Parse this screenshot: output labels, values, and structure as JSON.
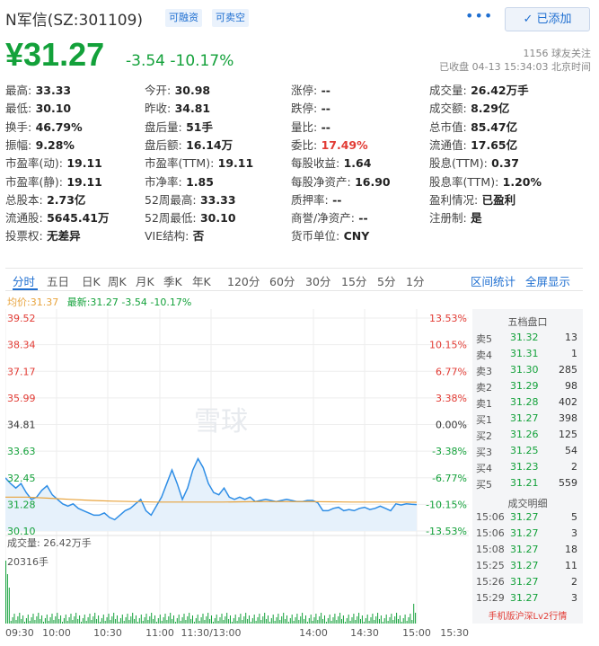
{
  "header": {
    "name": "N军信(SZ:301109)",
    "tags": [
      "可融资",
      "可卖空"
    ],
    "more": "•••",
    "follow_label": "✓ 已添加"
  },
  "price": {
    "current": "¥31.27",
    "change": "-3.54 -10.17%",
    "followers": "1156 球友关注",
    "status": "已收盘 04-13 15:34:03 北京时间"
  },
  "quote": [
    {
      "k": "最高:",
      "v": "33.33"
    },
    {
      "k": "今开:",
      "v": "30.98"
    },
    {
      "k": "涨停:",
      "v": "--"
    },
    {
      "k": "成交量:",
      "v": "26.42万手"
    },
    {
      "k": "最低:",
      "v": "30.10"
    },
    {
      "k": "昨收:",
      "v": "34.81"
    },
    {
      "k": "跌停:",
      "v": "--"
    },
    {
      "k": "成交额:",
      "v": "8.29亿"
    },
    {
      "k": "换手:",
      "v": "46.79%"
    },
    {
      "k": "盘后量:",
      "v": "51手"
    },
    {
      "k": "量比:",
      "v": "--"
    },
    {
      "k": "总市值:",
      "v": "85.47亿"
    },
    {
      "k": "振幅:",
      "v": "9.28%"
    },
    {
      "k": "盘后额:",
      "v": "16.14万"
    },
    {
      "k": "委比:",
      "v": "17.49%"
    },
    {
      "k": "流通值:",
      "v": "17.65亿"
    },
    {
      "k": "市盈率(动):",
      "v": "19.11"
    },
    {
      "k": "市盈率(TTM):",
      "v": "19.11"
    },
    {
      "k": "每股收益:",
      "v": "1.64"
    },
    {
      "k": "股息(TTM):",
      "v": "0.37"
    },
    {
      "k": "市盈率(静):",
      "v": "19.11"
    },
    {
      "k": "市净率:",
      "v": "1.85"
    },
    {
      "k": "每股净资产:",
      "v": "16.90"
    },
    {
      "k": "股息率(TTM):",
      "v": "1.20%"
    },
    {
      "k": "总股本:",
      "v": "2.73亿"
    },
    {
      "k": "52周最高:",
      "v": "33.33"
    },
    {
      "k": "质押率:",
      "v": "--"
    },
    {
      "k": "盈利情况:",
      "v": "已盈利"
    },
    {
      "k": "流通股:",
      "v": "5645.41万"
    },
    {
      "k": "52周最低:",
      "v": "30.10"
    },
    {
      "k": "商誉/净资产:",
      "v": "--"
    },
    {
      "k": "注册制:",
      "v": "是"
    },
    {
      "k": "投票权:",
      "v": "无差异"
    },
    {
      "k": "VIE结构:",
      "v": "否"
    },
    {
      "k": "货币单位:",
      "v": "CNY"
    }
  ],
  "tabs": [
    "分时",
    "五日",
    "日K",
    "周K",
    "月K",
    "季K",
    "年K",
    "120分",
    "60分",
    "30分",
    "15分",
    "5分",
    "1分"
  ],
  "tab_actions": [
    "区间统计",
    "全屏显示"
  ],
  "avg_line": {
    "avg": "均价:31.37",
    "latest": "最新:31.27 -3.54 -10.17%"
  },
  "chart_data": {
    "type": "line",
    "y_ticks": [
      "39.52",
      "38.34",
      "37.17",
      "35.99",
      "34.81",
      "33.63",
      "32.45",
      "31.28",
      "30.10"
    ],
    "pct_ticks": [
      "13.53%",
      "10.15%",
      "6.77%",
      "3.38%",
      "0.00%",
      "-3.38%",
      "-6.77%",
      "-10.15%",
      "-13.53%"
    ],
    "x_ticks": [
      "09:30",
      "10:00",
      "10:30",
      "11:00",
      "11:30/13:00",
      "14:00",
      "14:30",
      "15:00",
      "15:30"
    ],
    "watermark": "雪球",
    "volume_label": "成交量: 26.42万手",
    "volume_max_label": "20316手",
    "ylim": [
      30.1,
      39.52
    ],
    "price": [
      32.45,
      32.2,
      32.0,
      32.2,
      31.8,
      31.5,
      31.6,
      31.9,
      32.1,
      31.7,
      31.5,
      31.3,
      31.2,
      31.3,
      31.1,
      31.0,
      30.9,
      30.8,
      30.8,
      30.9,
      30.7,
      30.6,
      30.8,
      31.0,
      31.1,
      31.3,
      31.5,
      31.0,
      30.8,
      31.2,
      31.6,
      32.2,
      32.8,
      32.2,
      31.5,
      32.0,
      32.8,
      33.3,
      32.9,
      32.2,
      31.8,
      31.7,
      32.0,
      31.6,
      31.5,
      31.6,
      31.5,
      31.6,
      31.4,
      31.45,
      31.5,
      31.45,
      31.4,
      31.45,
      31.5,
      31.45,
      31.4,
      31.4,
      31.45,
      31.45,
      31.35,
      31.0,
      31.0,
      31.1,
      31.15,
      31.0,
      31.05,
      31.0,
      31.1,
      31.15,
      31.05,
      31.1,
      31.2,
      31.1,
      31.0,
      31.3,
      31.25,
      31.3,
      31.28,
      31.27
    ],
    "avg": [
      31.6,
      31.6,
      31.55,
      31.5,
      31.45,
      31.42,
      31.4,
      31.38,
      31.38,
      31.38,
      31.38,
      31.39,
      31.4,
      31.4,
      31.4,
      31.39,
      31.38,
      31.38,
      31.38,
      31.37
    ],
    "volume_color": "#13a13a"
  },
  "orderbook": {
    "title": "五档盘口",
    "asks": [
      [
        "卖5",
        "31.32",
        "13"
      ],
      [
        "卖4",
        "31.31",
        "1"
      ],
      [
        "卖3",
        "31.30",
        "285"
      ],
      [
        "卖2",
        "31.29",
        "98"
      ],
      [
        "卖1",
        "31.28",
        "402"
      ]
    ],
    "bids": [
      [
        "买1",
        "31.27",
        "398"
      ],
      [
        "买2",
        "31.26",
        "125"
      ],
      [
        "买3",
        "31.25",
        "54"
      ],
      [
        "买4",
        "31.23",
        "2"
      ],
      [
        "买5",
        "31.21",
        "559"
      ]
    ],
    "detail_title": "成交明细",
    "trades": [
      [
        "15:06",
        "31.27",
        "5"
      ],
      [
        "15:06",
        "31.27",
        "3"
      ],
      [
        "15:08",
        "31.27",
        "18"
      ],
      [
        "15:25",
        "31.27",
        "11"
      ],
      [
        "15:26",
        "31.27",
        "2"
      ],
      [
        "15:29",
        "31.27",
        "3"
      ]
    ],
    "footer": "手机版沪深Lv2行情"
  }
}
